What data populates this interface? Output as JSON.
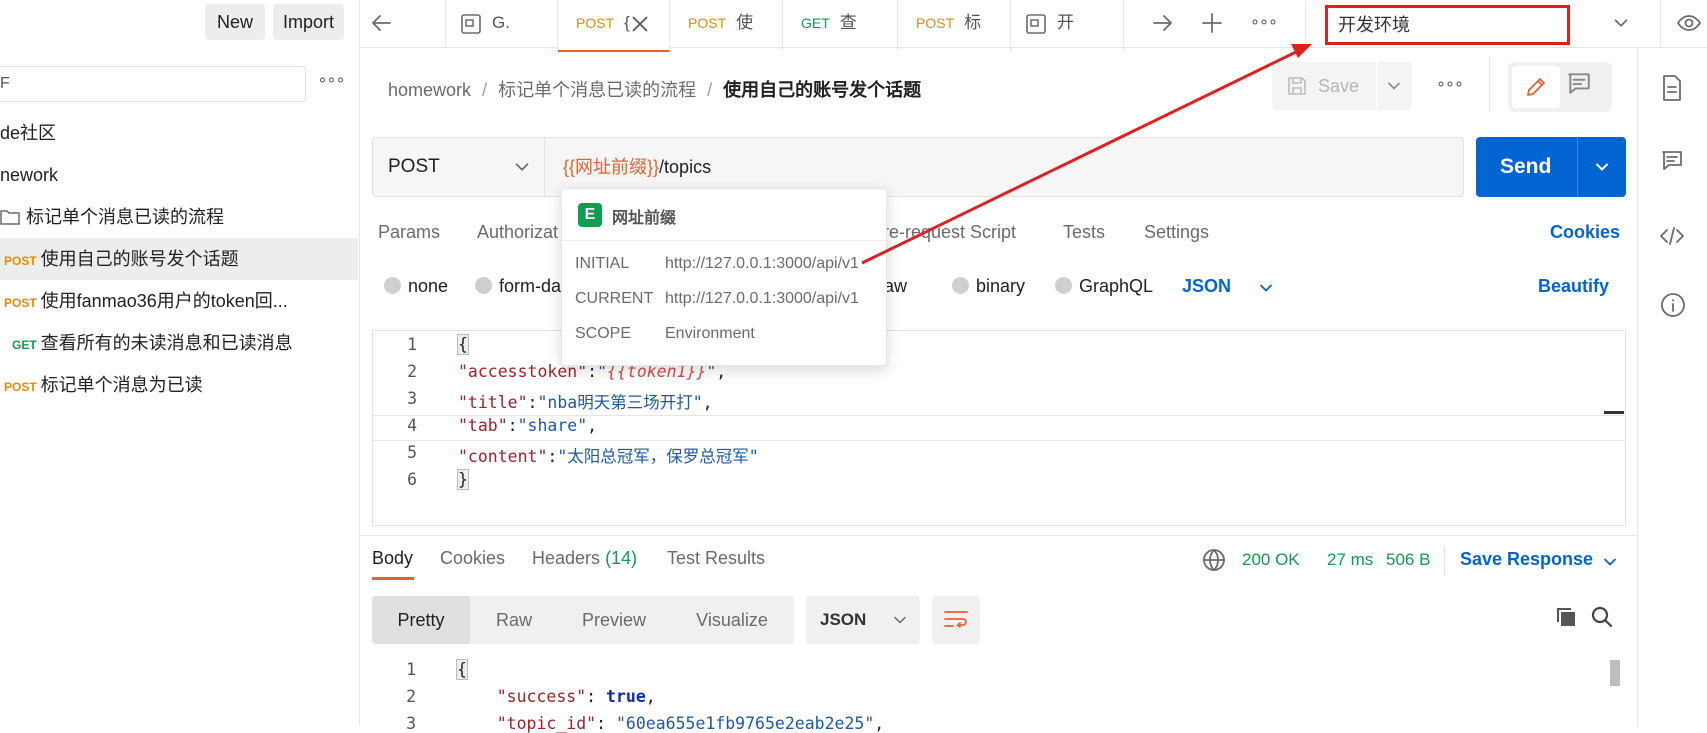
{
  "sidebar": {
    "new_label": "New",
    "import_label": "Import",
    "search_value": "F",
    "items": [
      {
        "label": "de社区",
        "method": "",
        "indent": 0
      },
      {
        "label": "nework",
        "method": "",
        "indent": 0
      },
      {
        "label": "标记单个消息已读的流程",
        "method": "",
        "indent": 1
      },
      {
        "label": "使用自己的账号发个话题",
        "method": "POST",
        "indent": 2
      },
      {
        "label": "使用fanmao36用户的token回...",
        "method": "POST",
        "indent": 2
      },
      {
        "label": "查看所有的未读消息和已读消息",
        "method": "GET",
        "indent": 2
      },
      {
        "label": "标记单个消息为已读",
        "method": "POST",
        "indent": 2
      }
    ]
  },
  "tabs": [
    {
      "method": "",
      "label": "G."
    },
    {
      "method": "POST",
      "label": "{"
    },
    {
      "method": "POST",
      "label": "使"
    },
    {
      "method": "GET",
      "label": "查"
    },
    {
      "method": "POST",
      "label": "标"
    },
    {
      "method": "",
      "label": "开"
    }
  ],
  "env_select": {
    "value": "开发环境"
  },
  "breadcrumb": {
    "collection": "homework",
    "folder": "标记单个消息已读的流程",
    "request": "使用自己的账号发个话题"
  },
  "toolbar": {
    "save_label": "Save"
  },
  "request": {
    "method": "POST",
    "url_var": "{{网址前缀}}",
    "url_path": "/topics",
    "send_label": "Send",
    "tabs": [
      "Params",
      "Authorizat",
      "re-request Script",
      "Tests",
      "Settings"
    ],
    "cookies_label": "Cookies",
    "body_types": [
      "none",
      "form-da",
      "raw",
      "binary",
      "GraphQL"
    ],
    "body_format": "JSON",
    "beautify_label": "Beautify",
    "body_lines": [
      {
        "n": "1",
        "t": "{"
      },
      {
        "n": "2",
        "k": "\"accesstoken\"",
        "p": ":",
        "q": "\"",
        "var": "{{token1}}",
        "q2": "\"",
        "e": ","
      },
      {
        "n": "3",
        "k": "\"title\"",
        "p": ":",
        "s": "\"nba明天第三场开打\"",
        "e": ","
      },
      {
        "n": "4",
        "k": "\"tab\"",
        "p": ":",
        "s": "\"share\"",
        "e": ","
      },
      {
        "n": "5",
        "k": "\"content\"",
        "p": ":",
        "s": "\"太阳总冠军，保罗总冠军\"",
        "e": ""
      },
      {
        "n": "6",
        "t": "}"
      }
    ]
  },
  "tooltip": {
    "badge": "E",
    "title": "网址前缀",
    "rows": [
      {
        "key": "INITIAL",
        "val": "http://127.0.0.1:3000/api/v1"
      },
      {
        "key": "CURRENT",
        "val": "http://127.0.0.1:3000/api/v1"
      },
      {
        "key": "SCOPE",
        "val": "Environment"
      }
    ]
  },
  "response": {
    "tabs": {
      "body": "Body",
      "cookies": "Cookies",
      "headers": "Headers",
      "headers_count": "(14)",
      "tests": "Test Results"
    },
    "status": "200 OK",
    "time": "27 ms",
    "size": "506 B",
    "save_label": "Save Response",
    "view_modes": [
      "Pretty",
      "Raw",
      "Preview",
      "Visualize"
    ],
    "format": "JSON",
    "lines": [
      {
        "n": "1",
        "t": "{"
      },
      {
        "n": "2",
        "k": "\"success\"",
        "v": "true"
      },
      {
        "n": "3",
        "k": "\"topic_id\"",
        "s": "\"60ea655e1fb9765e2eab2e25\""
      }
    ]
  },
  "colors": {
    "accent": "#0265d2",
    "post": "#e88a00",
    "get": "#0e9e4e",
    "annotation": "#e02020"
  }
}
